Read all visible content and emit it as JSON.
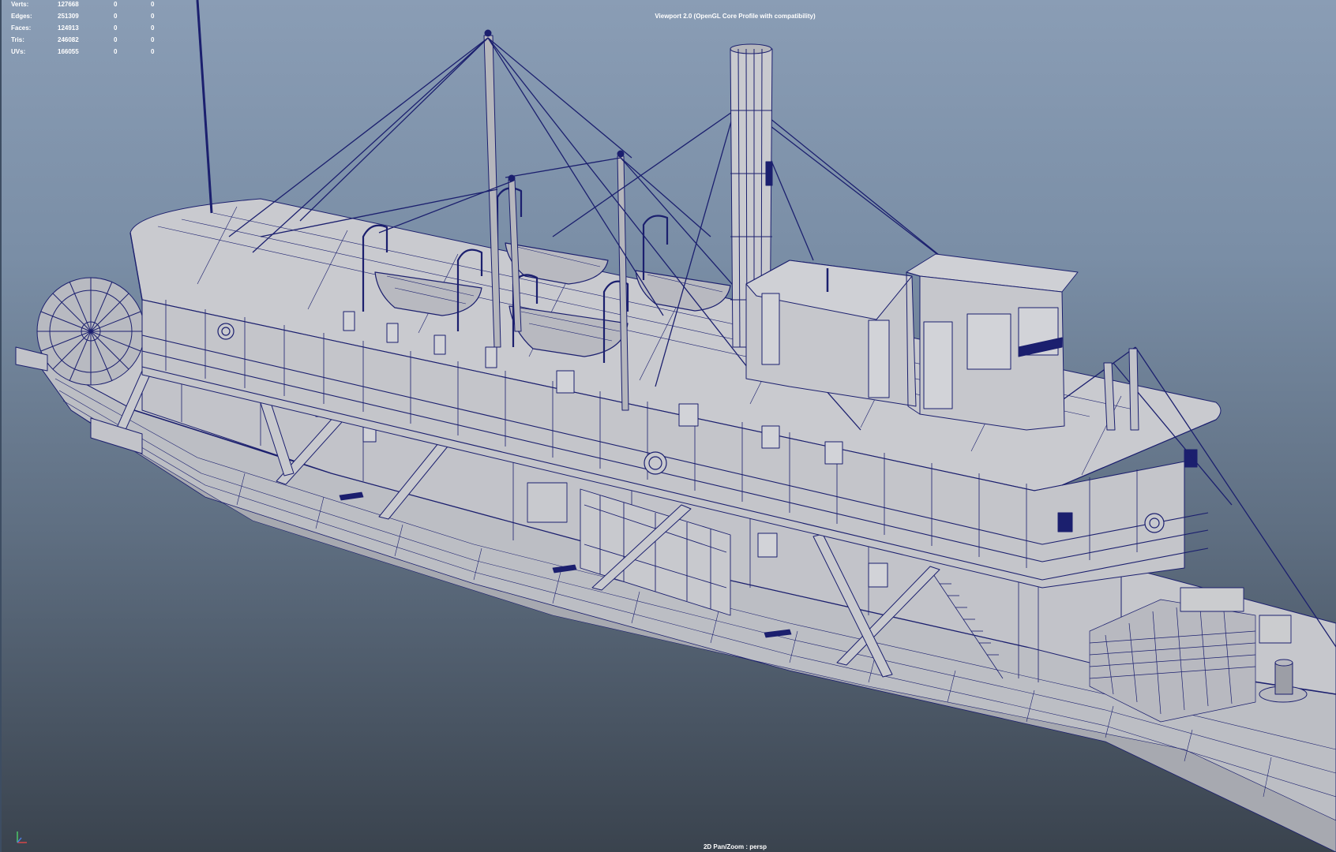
{
  "viewport": {
    "renderer": "Viewport 2.0 (OpenGL Core Profile with compatibility)",
    "camera_label": "2D Pan/Zoom : persp"
  },
  "hud": {
    "rows": [
      {
        "label": "Verts:",
        "total": "127668",
        "selected": "0",
        "components": "0"
      },
      {
        "label": "Edges:",
        "total": "251309",
        "selected": "0",
        "components": "0"
      },
      {
        "label": "Faces:",
        "total": "124913",
        "selected": "0",
        "components": "0"
      },
      {
        "label": "Tris:",
        "total": "246082",
        "selected": "0",
        "components": "0"
      },
      {
        "label": "UVs:",
        "total": "166055",
        "selected": "0",
        "components": "0"
      }
    ]
  },
  "colors": {
    "wireframe": "#1b1f6e",
    "hull_fill": "#bfc0c6",
    "hull_shade": "#a9abb2",
    "background_top": "#8a9db5",
    "background_bottom": "#3a434e"
  },
  "icons": {
    "axis": "axis-gizmo-icon"
  }
}
